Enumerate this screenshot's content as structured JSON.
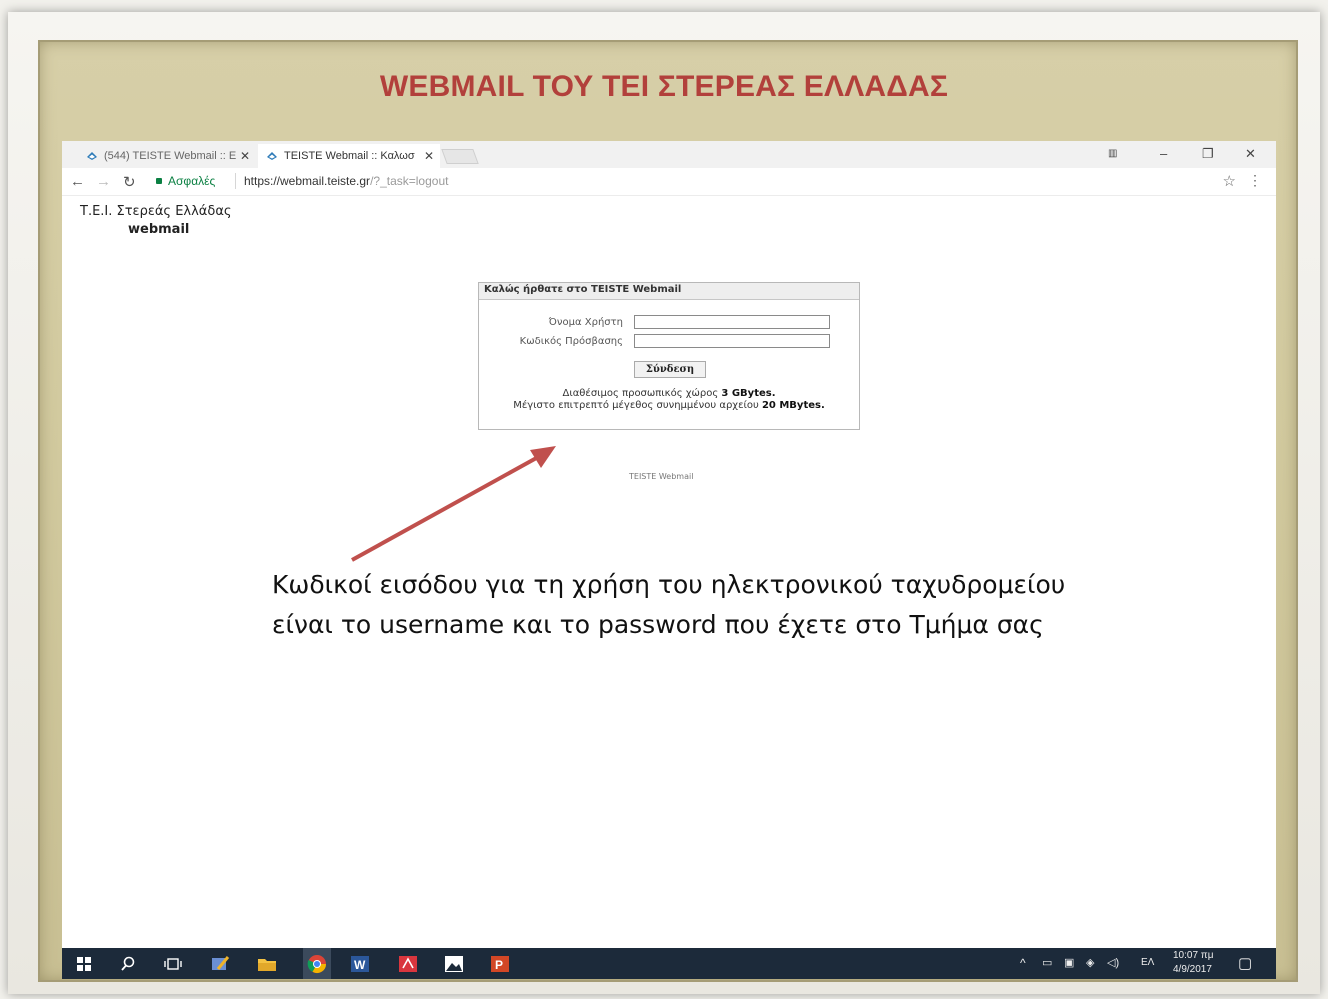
{
  "slide": {
    "title": "WEBMAIL ΤΟΥ ΤΕΙ ΣΤΕΡΕΑΣ ΕΛΛΑΔΑΣ"
  },
  "browser": {
    "tabs": [
      {
        "label": "(544) TEISTE Webmail :: Ε",
        "state": "inactive"
      },
      {
        "label": "TEISTE Webmail :: Καλωσ",
        "state": "active"
      }
    ],
    "secure_label": "Ασφαλές",
    "url_host": "https://webmail.teiste.gr",
    "url_path": "/?_task=logout",
    "icons": {
      "back": "back-arrow-icon",
      "forward": "forward-arrow-icon",
      "reload": "reload-icon",
      "bookmark": "star-icon",
      "menu": "kebab-menu-icon"
    }
  },
  "page": {
    "institution": "Τ.Ε.Ι. Στερεάς Ελλάδας",
    "brand": "webmail",
    "login": {
      "header": "Καλώς ήρθατε στο TEISTE Webmail",
      "username_label": "Όνομα Χρήστη",
      "password_label": "Κωδικός Πρόσβασης",
      "username_value": "",
      "password_value": "",
      "submit_label": "Σύνδεση",
      "quota_text": "Διαθέσιμος προσωπικός χώρος ",
      "quota_value": "3 GBytes.",
      "attachment_text": "Μέγιστο επιτρεπτό μέγεθος συνημμένου αρχείου ",
      "attachment_value": "20 MBytes."
    },
    "footer": "TEISTE Webmail"
  },
  "annotation": {
    "line1": "Κωδικοί εισόδου για τη χρήση του ηλεκτρονικού ταχυδρομείου",
    "line2": "είναι το username και το password που έχετε στο Τμήμα σας",
    "arrow_color": "#c0504d"
  },
  "taskbar": {
    "apps": [
      "windows-start-icon",
      "search-icon",
      "task-view-icon",
      "paint-icon",
      "file-explorer-icon",
      "chrome-icon",
      "word-icon",
      "acrobat-icon",
      "photos-icon",
      "powerpoint-icon"
    ],
    "language": "ΕΛ",
    "time": "10:07 πμ",
    "date": "4/9/2017"
  }
}
